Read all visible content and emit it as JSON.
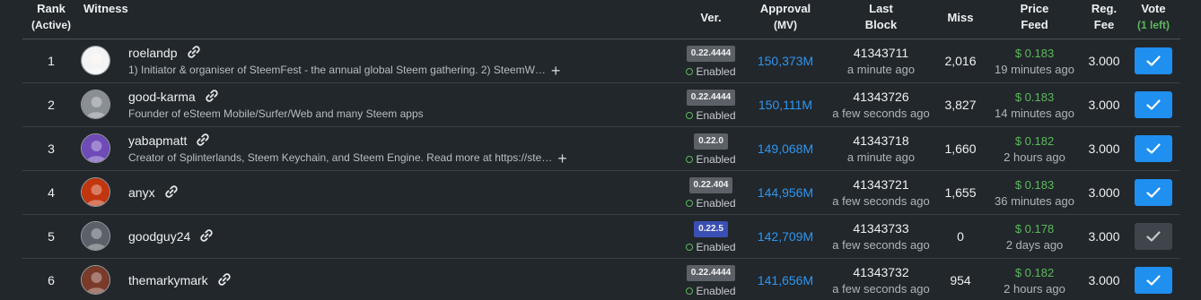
{
  "header": {
    "rank": "Rank",
    "rank_sub": "(Active)",
    "witness": "Witness",
    "ver": "Ver.",
    "approval": "Approval",
    "approval_sub": "(MV)",
    "last": "Last",
    "last_sub": "Block",
    "miss": "Miss",
    "price": "Price",
    "price_sub": "Feed",
    "reg": "Reg.",
    "reg_sub": "Fee",
    "vote": "Vote",
    "vote_sub": "(1 left)"
  },
  "rows": [
    {
      "rank": "1",
      "name": "roelandp",
      "desc": "1) Initiator & organiser of SteemFest - the annual global Steem gathering. 2) SteemW…",
      "has_plus": true,
      "version": "0.22.4444",
      "status": "Enabled",
      "approval": "150,373M",
      "block": "41343711",
      "block_time": "a minute ago",
      "miss": "2,016",
      "price": "$ 0.183",
      "price_time": "19 minutes ago",
      "fee": "3.000",
      "voted": true,
      "avatar_color": "#f4f4f4"
    },
    {
      "rank": "2",
      "name": "good-karma",
      "desc": "Founder of eSteem Mobile/Surfer/Web and many Steem apps",
      "has_plus": false,
      "version": "0.22.4444",
      "status": "Enabled",
      "approval": "150,111M",
      "block": "41343726",
      "block_time": "a few seconds ago",
      "miss": "3,827",
      "price": "$ 0.183",
      "price_time": "14 minutes ago",
      "fee": "3.000",
      "voted": true,
      "avatar_color": "#8a8f95"
    },
    {
      "rank": "3",
      "name": "yabapmatt",
      "desc": "Creator of Splinterlands, Steem Keychain, and Steem Engine. Read more at https://ste…",
      "has_plus": true,
      "version": "0.22.0",
      "status": "Enabled",
      "approval": "149,068M",
      "block": "41343718",
      "block_time": "a minute ago",
      "miss": "1,660",
      "price": "$ 0.182",
      "price_time": "2 hours ago",
      "fee": "3.000",
      "voted": true,
      "avatar_color": "#6f4bb8"
    },
    {
      "rank": "4",
      "name": "anyx",
      "desc": "",
      "has_plus": false,
      "version": "0.22.404",
      "status": "Enabled",
      "approval": "144,956M",
      "block": "41343721",
      "block_time": "a few seconds ago",
      "miss": "1,655",
      "price": "$ 0.183",
      "price_time": "36 minutes ago",
      "fee": "3.000",
      "voted": true,
      "avatar_color": "#c2360f"
    },
    {
      "rank": "5",
      "name": "goodguy24",
      "desc": "",
      "has_plus": false,
      "version": "0.22.5",
      "status": "Enabled",
      "approval": "142,709M",
      "block": "41343733",
      "block_time": "a few seconds ago",
      "miss": "0",
      "price": "$ 0.178",
      "price_time": "2 days ago",
      "fee": "3.000",
      "voted": false,
      "avatar_color": "#5b6168"
    },
    {
      "rank": "6",
      "name": "themarkymark",
      "desc": "",
      "has_plus": false,
      "version": "0.22.4444",
      "status": "Enabled",
      "approval": "141,656M",
      "block": "41343732",
      "block_time": "a few seconds ago",
      "miss": "954",
      "price": "$ 0.182",
      "price_time": "2 hours ago",
      "fee": "3.000",
      "voted": true,
      "avatar_color": "#7a3a2a"
    }
  ],
  "colors": {
    "background": "#22272b",
    "accent_blue": "#1f8ff0",
    "link_blue": "#2f96f0",
    "green": "#5cb85c",
    "version_badge": "#5c6167",
    "version_badge_new": "#3a4fb3",
    "vote_off": "#3f454b"
  },
  "icons": {
    "link": "link-icon",
    "expand": "plus-icon",
    "vote": "check-icon",
    "status": "circle-icon",
    "avatar_placeholder": "user-icon"
  }
}
